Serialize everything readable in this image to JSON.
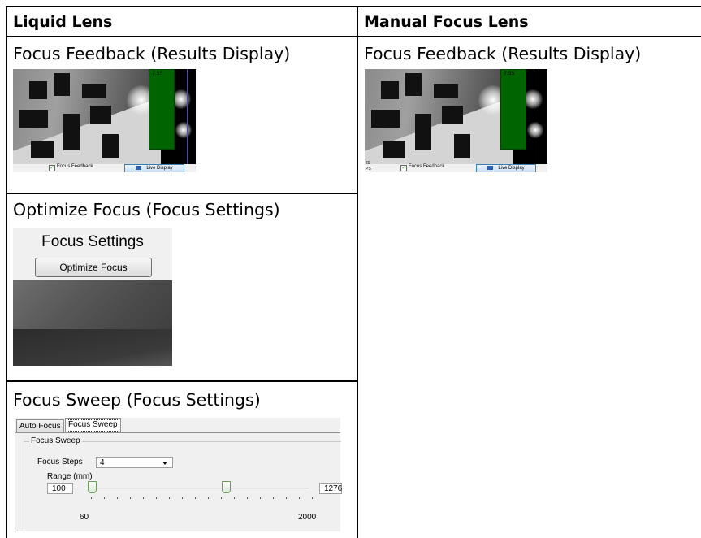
{
  "headers": {
    "left": "Liquid Lens",
    "right": "Manual Focus Lens"
  },
  "left_col": {
    "row1_title": "Focus Feedback (Results Display)",
    "row2_title": "Optimize Focus (Focus Settings)",
    "row3_title": "Focus Sweep (Focus Settings)"
  },
  "right_col": {
    "row1_title": "Focus Feedback (Results Display)"
  },
  "feedback_shot": {
    "bar_value": "7.55",
    "checkbox_label": "Focus Feedback",
    "button_label": "Live Display",
    "checkbox_checked": true,
    "bar_color": "#006400",
    "left_edge_text_a": "60",
    "left_edge_text_b": "PS"
  },
  "optimize_shot": {
    "title": "Focus Settings",
    "button_label": "Optimize Focus"
  },
  "sweep_shot": {
    "tabs": [
      "Auto Focus",
      "Focus Sweep"
    ],
    "active_tab": "Focus Sweep",
    "group_label": "Focus Sweep",
    "steps_label": "Focus Steps",
    "steps_value": "4",
    "range_label": "Range (mm)",
    "range_min_value": "100",
    "range_max_value": "1276",
    "scale_min": "60",
    "scale_max": "2000"
  },
  "colors": {
    "border": "#000000",
    "live_button_border": "#3c7fb1",
    "slider_thumb": "#6b9a5a"
  }
}
